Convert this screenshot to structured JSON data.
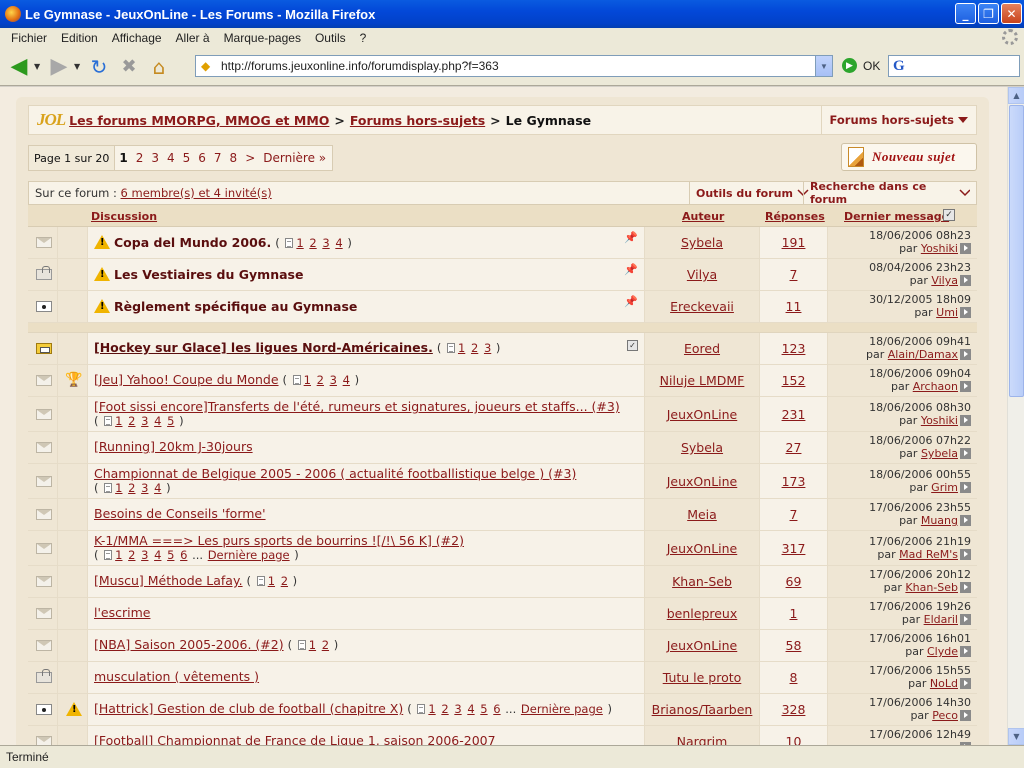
{
  "window": {
    "title": "Le Gymnase - JeuxOnLine - Les Forums - Mozilla Firefox",
    "minimize": "_",
    "maximize": "❐",
    "close": "✕"
  },
  "menu": [
    "Fichier",
    "Edition",
    "Affichage",
    "Aller à",
    "Marque-pages",
    "Outils",
    "?"
  ],
  "nav": {
    "url": "http://forums.jeuxonline.info/forumdisplay.php?f=363",
    "go_label": "OK",
    "status": "Terminé"
  },
  "breadcrumb": {
    "logo": "JOL",
    "items": [
      "Les forums MMORPG, MMOG et MMO",
      "Forums hors-sujets"
    ],
    "separator": ">",
    "current": "Le Gymnase",
    "dropdown": "Forums hors-sujets"
  },
  "pagination": {
    "info": "Page 1 sur 20",
    "current": "1",
    "pages": [
      "2",
      "3",
      "4",
      "5",
      "6",
      "7",
      "8"
    ],
    "next": ">",
    "last": "Dernière »"
  },
  "new_topic": "Nouveau sujet",
  "forum_tools": {
    "prefix": "Sur ce forum :",
    "online": "6 membre(s) et 4 invité(s)",
    "tools": "Outils du forum",
    "search": "Recherche dans ce forum"
  },
  "table_headers": {
    "discussion": "Discussion",
    "author": "Auteur",
    "replies": "Réponses",
    "last": "Dernier message"
  },
  "last_by_prefix": "par",
  "sticky_threads": [
    {
      "icon": "envelope-icon",
      "title": "Copa del Mundo 2006.",
      "pages": [
        "1",
        "2",
        "3",
        "4"
      ],
      "author": "Sybela",
      "replies": "191",
      "date": "18/06/2006 08h23",
      "by": "Yoshiki"
    },
    {
      "icon": "locked-icon",
      "title": "Les Vestiaires du Gymnase",
      "pages": [],
      "author": "Vilya",
      "replies": "7",
      "date": "08/04/2006 23h23",
      "by": "Vilya"
    },
    {
      "icon": "dot-icon",
      "title": "Règlement spécifique au Gymnase",
      "pages": [],
      "author": "Ereckevaii",
      "replies": "11",
      "date": "30/12/2005 18h09",
      "by": "Umi"
    }
  ],
  "threads": [
    {
      "icon": "hot-icon",
      "prefix": "",
      "title": "[Hockey sur Glace] les ligues Nord-Américaines.",
      "pages": [
        "1",
        "2",
        "3"
      ],
      "author": "Eored",
      "replies": "123",
      "date": "18/06/2006 09h41",
      "by": "Alain/Damax",
      "bold": true,
      "subscribed": true
    },
    {
      "icon": "envelope-icon",
      "prefix": "trophy-icon",
      "title": "[Jeu] Yahoo! Coupe du Monde",
      "pages": [
        "1",
        "2",
        "3",
        "4"
      ],
      "author": "Niluje LMDMF",
      "replies": "152",
      "date": "18/06/2006 09h04",
      "by": "Archaon"
    },
    {
      "icon": "envelope-icon",
      "prefix": "",
      "title": "[Foot sissi encore]Transferts de l'été, rumeurs et signatures, joueurs et staffs... (#3)",
      "pages": [
        "1",
        "2",
        "3",
        "4",
        "5"
      ],
      "author": "JeuxOnLine",
      "replies": "231",
      "date": "18/06/2006 08h30",
      "by": "Yoshiki",
      "tall": true
    },
    {
      "icon": "envelope-icon",
      "prefix": "",
      "title": "[Running] 20km J-30jours",
      "pages": [],
      "author": "Sybela",
      "replies": "27",
      "date": "18/06/2006 07h22",
      "by": "Sybela"
    },
    {
      "icon": "envelope-icon",
      "prefix": "",
      "title": "Championnat de Belgique 2005 - 2006 ( actualité footballistique belge ) (#3)",
      "pages": [
        "1",
        "2",
        "3",
        "4"
      ],
      "author": "JeuxOnLine",
      "replies": "173",
      "date": "18/06/2006 00h55",
      "by": "Grim",
      "tall": true
    },
    {
      "icon": "envelope-icon",
      "prefix": "",
      "title": "Besoins de Conseils 'forme'",
      "pages": [],
      "author": "Meia",
      "replies": "7",
      "date": "17/06/2006 23h55",
      "by": "Muang"
    },
    {
      "icon": "envelope-icon",
      "prefix": "",
      "title": "K-1/MMA ===> Les purs sports de bourrins ![/!\\ 56 K] (#2)",
      "pages": [
        "1",
        "2",
        "3",
        "4",
        "5",
        "6"
      ],
      "pages_more": "...",
      "pages_last": "Dernière page",
      "author": "JeuxOnLine",
      "replies": "317",
      "date": "17/06/2006 21h19",
      "by": "Mad ReM's",
      "tall": true
    },
    {
      "icon": "envelope-icon",
      "prefix": "",
      "title": "[Muscu] Méthode Lafay.",
      "pages": [
        "1",
        "2"
      ],
      "author": "Khan-Seb",
      "replies": "69",
      "date": "17/06/2006 20h12",
      "by": "Khan-Seb"
    },
    {
      "icon": "envelope-icon",
      "prefix": "",
      "title": "l'escrime",
      "pages": [],
      "author": "benlepreux",
      "replies": "1",
      "date": "17/06/2006 19h26",
      "by": "Eldaril"
    },
    {
      "icon": "envelope-icon",
      "prefix": "",
      "title": "[NBA] Saison 2005-2006. (#2)",
      "pages": [
        "1",
        "2"
      ],
      "author": "JeuxOnLine",
      "replies": "58",
      "date": "17/06/2006 16h01",
      "by": "Clyde"
    },
    {
      "icon": "locked-icon",
      "prefix": "",
      "title": "musculation ( vêtements )",
      "pages": [],
      "author": "Tutu le proto",
      "replies": "8",
      "date": "17/06/2006 15h55",
      "by": "NoLd"
    },
    {
      "icon": "dot-icon",
      "prefix": "warning-icon",
      "title": "[Hattrick] Gestion de club de football (chapitre X)",
      "pages": [
        "1",
        "2",
        "3",
        "4",
        "5",
        "6"
      ],
      "pages_more": "...",
      "pages_last": "Dernière page",
      "author": "Brianos/Taarben",
      "replies": "328",
      "date": "17/06/2006 14h30",
      "by": "Peco"
    },
    {
      "icon": "envelope-icon",
      "prefix": "",
      "title": "[Football] Championnat de France de Ligue 1, saison 2006-2007",
      "pages": [],
      "author": "Nargrim",
      "replies": "10",
      "date": "17/06/2006 12h49",
      "by": ""
    }
  ]
}
